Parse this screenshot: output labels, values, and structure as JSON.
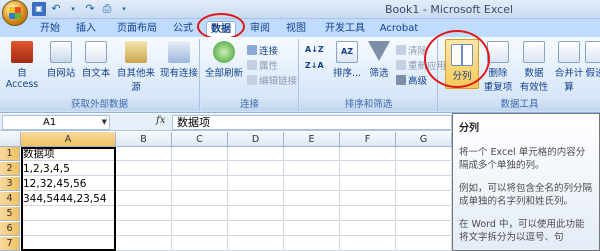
{
  "title_bar": {
    "title": "Book1 - Microsoft Excel"
  },
  "tabs": [
    {
      "label": "开始"
    },
    {
      "label": "插入"
    },
    {
      "label": "页面布局"
    },
    {
      "label": "公式"
    },
    {
      "label": "数据"
    },
    {
      "label": "审阅"
    },
    {
      "label": "视图"
    },
    {
      "label": "开发工具"
    },
    {
      "label": "Acrobat"
    }
  ],
  "ribbon": {
    "get_external": {
      "label": "获取外部数据",
      "buttons": [
        "自 Access",
        "自网站",
        "自文本",
        "自其他来源",
        "现有连接"
      ]
    },
    "connections": {
      "label": "连接",
      "refresh": "全部刷新",
      "connections": "连接",
      "properties": "属性",
      "edit_links": "编辑链接"
    },
    "sort_filter": {
      "label": "排序和筛选",
      "sort": "排序...",
      "filter": "筛选",
      "clear": "清除",
      "reapply": "重新应用",
      "advanced": "高级"
    },
    "data_tools": {
      "label": "数据工具",
      "text_to_columns": "分列",
      "remove_dup_line1": "删除",
      "remove_dup_line2": "重复项",
      "validation_line1": "数据",
      "validation_line2": "有效性",
      "consolidate": "合并计算",
      "whatif": "假设"
    }
  },
  "formula_bar": {
    "name_box": "A1",
    "fx": "fx",
    "value": "数据项"
  },
  "sheet": {
    "columns": [
      "A",
      "B",
      "C",
      "D",
      "E",
      "F",
      "G"
    ],
    "rows": [
      "1",
      "2",
      "3",
      "4",
      "5",
      "6",
      "7"
    ],
    "cells": [
      "数据项",
      "1,2,3,4,5",
      "12,32,45,56",
      "344,5444,23,54",
      "",
      "",
      ""
    ]
  },
  "tooltip": {
    "title": "分列",
    "p1": "将一个 Excel 单元格的内容分隔成多个单独的列。",
    "p2": "例如，可以将包含全名的列分隔成单独的名字列和姓氏列。",
    "p3": "在 Word 中，可以使用此功能将文字拆分为以逗号、句"
  },
  "colors": {
    "annotation_circle": "#e01818",
    "tab_bar": "#bfdbff",
    "selection": "#f1c15f"
  }
}
